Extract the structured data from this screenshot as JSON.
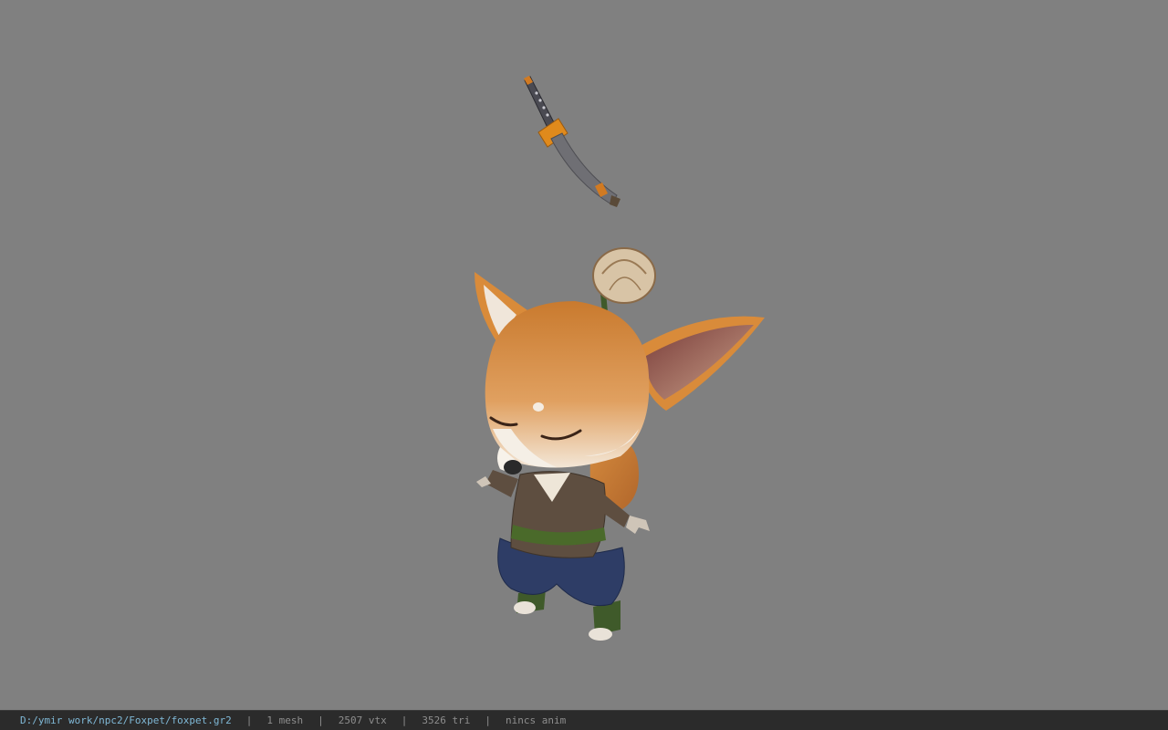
{
  "status_bar": {
    "file_path": "D:/ymir work/npc2/Foxpet/foxpet.gr2",
    "separator": "|",
    "mesh_count": "1 mesh",
    "vertex_count": "2507 vtx",
    "triangle_count": "3526 tri",
    "anim_info": "nincs anim"
  },
  "colors": {
    "viewport_background": "#808080",
    "status_bar_background": "#2b2b2b",
    "path_text": "#7fb8d6",
    "info_text": "#8e8e8e",
    "fur": "#d98b3a",
    "jacket": "#5e4e40",
    "pants": "#2e3d66",
    "sash": "#4a6a2a"
  },
  "icons": {
    "model": "fox-character-model",
    "weapon": "katana-sword"
  }
}
